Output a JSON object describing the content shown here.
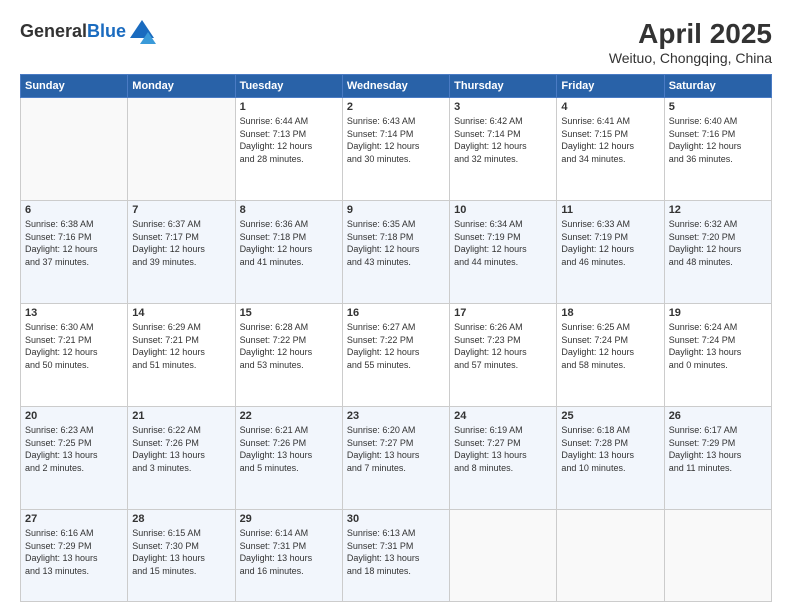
{
  "logo": {
    "general": "General",
    "blue": "Blue"
  },
  "title": "April 2025",
  "subtitle": "Weituo, Chongqing, China",
  "days_header": [
    "Sunday",
    "Monday",
    "Tuesday",
    "Wednesday",
    "Thursday",
    "Friday",
    "Saturday"
  ],
  "weeks": [
    [
      {
        "num": "",
        "info": ""
      },
      {
        "num": "",
        "info": ""
      },
      {
        "num": "1",
        "info": "Sunrise: 6:44 AM\nSunset: 7:13 PM\nDaylight: 12 hours\nand 28 minutes."
      },
      {
        "num": "2",
        "info": "Sunrise: 6:43 AM\nSunset: 7:14 PM\nDaylight: 12 hours\nand 30 minutes."
      },
      {
        "num": "3",
        "info": "Sunrise: 6:42 AM\nSunset: 7:14 PM\nDaylight: 12 hours\nand 32 minutes."
      },
      {
        "num": "4",
        "info": "Sunrise: 6:41 AM\nSunset: 7:15 PM\nDaylight: 12 hours\nand 34 minutes."
      },
      {
        "num": "5",
        "info": "Sunrise: 6:40 AM\nSunset: 7:16 PM\nDaylight: 12 hours\nand 36 minutes."
      }
    ],
    [
      {
        "num": "6",
        "info": "Sunrise: 6:38 AM\nSunset: 7:16 PM\nDaylight: 12 hours\nand 37 minutes."
      },
      {
        "num": "7",
        "info": "Sunrise: 6:37 AM\nSunset: 7:17 PM\nDaylight: 12 hours\nand 39 minutes."
      },
      {
        "num": "8",
        "info": "Sunrise: 6:36 AM\nSunset: 7:18 PM\nDaylight: 12 hours\nand 41 minutes."
      },
      {
        "num": "9",
        "info": "Sunrise: 6:35 AM\nSunset: 7:18 PM\nDaylight: 12 hours\nand 43 minutes."
      },
      {
        "num": "10",
        "info": "Sunrise: 6:34 AM\nSunset: 7:19 PM\nDaylight: 12 hours\nand 44 minutes."
      },
      {
        "num": "11",
        "info": "Sunrise: 6:33 AM\nSunset: 7:19 PM\nDaylight: 12 hours\nand 46 minutes."
      },
      {
        "num": "12",
        "info": "Sunrise: 6:32 AM\nSunset: 7:20 PM\nDaylight: 12 hours\nand 48 minutes."
      }
    ],
    [
      {
        "num": "13",
        "info": "Sunrise: 6:30 AM\nSunset: 7:21 PM\nDaylight: 12 hours\nand 50 minutes."
      },
      {
        "num": "14",
        "info": "Sunrise: 6:29 AM\nSunset: 7:21 PM\nDaylight: 12 hours\nand 51 minutes."
      },
      {
        "num": "15",
        "info": "Sunrise: 6:28 AM\nSunset: 7:22 PM\nDaylight: 12 hours\nand 53 minutes."
      },
      {
        "num": "16",
        "info": "Sunrise: 6:27 AM\nSunset: 7:22 PM\nDaylight: 12 hours\nand 55 minutes."
      },
      {
        "num": "17",
        "info": "Sunrise: 6:26 AM\nSunset: 7:23 PM\nDaylight: 12 hours\nand 57 minutes."
      },
      {
        "num": "18",
        "info": "Sunrise: 6:25 AM\nSunset: 7:24 PM\nDaylight: 12 hours\nand 58 minutes."
      },
      {
        "num": "19",
        "info": "Sunrise: 6:24 AM\nSunset: 7:24 PM\nDaylight: 13 hours\nand 0 minutes."
      }
    ],
    [
      {
        "num": "20",
        "info": "Sunrise: 6:23 AM\nSunset: 7:25 PM\nDaylight: 13 hours\nand 2 minutes."
      },
      {
        "num": "21",
        "info": "Sunrise: 6:22 AM\nSunset: 7:26 PM\nDaylight: 13 hours\nand 3 minutes."
      },
      {
        "num": "22",
        "info": "Sunrise: 6:21 AM\nSunset: 7:26 PM\nDaylight: 13 hours\nand 5 minutes."
      },
      {
        "num": "23",
        "info": "Sunrise: 6:20 AM\nSunset: 7:27 PM\nDaylight: 13 hours\nand 7 minutes."
      },
      {
        "num": "24",
        "info": "Sunrise: 6:19 AM\nSunset: 7:27 PM\nDaylight: 13 hours\nand 8 minutes."
      },
      {
        "num": "25",
        "info": "Sunrise: 6:18 AM\nSunset: 7:28 PM\nDaylight: 13 hours\nand 10 minutes."
      },
      {
        "num": "26",
        "info": "Sunrise: 6:17 AM\nSunset: 7:29 PM\nDaylight: 13 hours\nand 11 minutes."
      }
    ],
    [
      {
        "num": "27",
        "info": "Sunrise: 6:16 AM\nSunset: 7:29 PM\nDaylight: 13 hours\nand 13 minutes."
      },
      {
        "num": "28",
        "info": "Sunrise: 6:15 AM\nSunset: 7:30 PM\nDaylight: 13 hours\nand 15 minutes."
      },
      {
        "num": "29",
        "info": "Sunrise: 6:14 AM\nSunset: 7:31 PM\nDaylight: 13 hours\nand 16 minutes."
      },
      {
        "num": "30",
        "info": "Sunrise: 6:13 AM\nSunset: 7:31 PM\nDaylight: 13 hours\nand 18 minutes."
      },
      {
        "num": "",
        "info": ""
      },
      {
        "num": "",
        "info": ""
      },
      {
        "num": "",
        "info": ""
      }
    ]
  ]
}
